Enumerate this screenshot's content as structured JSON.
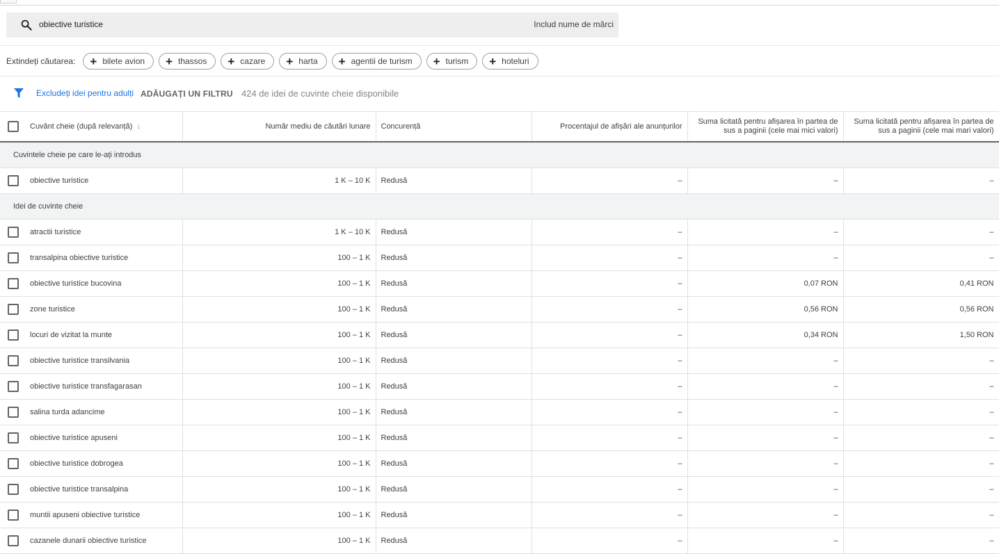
{
  "search": {
    "query": "obiective turistice",
    "brand_toggle": "Includ nume de mărci"
  },
  "expand": {
    "label": "Extindeți căutarea:",
    "chips": [
      "bilete avion",
      "thassos",
      "cazare",
      "harta",
      "agentii de turism",
      "turism",
      "hoteluri"
    ]
  },
  "filters": {
    "exclude_adult": "Excludeți idei pentru adulți",
    "add_filter": "ADĂUGAȚI UN FILTRU",
    "available_count": "424 de idei de cuvinte cheie disponibile"
  },
  "table": {
    "headers": {
      "keyword": "Cuvânt cheie (după relevanță)",
      "avg_searches": "Număr mediu de căutări lunare",
      "competition": "Concurență",
      "impr_share": "Procentajul de afișări ale anunțurilor",
      "bid_low_1": "Suma licitată pentru afișarea în partea de",
      "bid_low_2": "sus a paginii (cele mai mici valori)",
      "bid_high_1": "Suma licitată pentru afișarea în partea de",
      "bid_high_2": "sus a paginii (cele mai mari valori)"
    },
    "section_entered": "Cuvintele cheie pe care le-ați introdus",
    "entered_row": {
      "keyword": "obiective turistice",
      "searches": "1 K – 10 K",
      "competition": "Redusă",
      "share": "–",
      "low": "–",
      "high": "–"
    },
    "section_ideas": "Idei de cuvinte cheie",
    "rows": [
      {
        "keyword": "atractii turistice",
        "searches": "1 K – 10 K",
        "competition": "Redusă",
        "share": "–",
        "low": "–",
        "high": "–"
      },
      {
        "keyword": "transalpina obiective turistice",
        "searches": "100 – 1 K",
        "competition": "Redusă",
        "share": "–",
        "low": "–",
        "high": "–"
      },
      {
        "keyword": "obiective turistice bucovina",
        "searches": "100 – 1 K",
        "competition": "Redusă",
        "share": "–",
        "low": "0,07 RON",
        "high": "0,41 RON"
      },
      {
        "keyword": "zone turistice",
        "searches": "100 – 1 K",
        "competition": "Redusă",
        "share": "–",
        "low": "0,56 RON",
        "high": "0,56 RON"
      },
      {
        "keyword": "locuri de vizitat la munte",
        "searches": "100 – 1 K",
        "competition": "Redusă",
        "share": "–",
        "low": "0,34 RON",
        "high": "1,50 RON"
      },
      {
        "keyword": "obiective turistice transilvania",
        "searches": "100 – 1 K",
        "competition": "Redusă",
        "share": "–",
        "low": "–",
        "high": "–"
      },
      {
        "keyword": "obiective turistice transfagarasan",
        "searches": "100 – 1 K",
        "competition": "Redusă",
        "share": "–",
        "low": "–",
        "high": "–"
      },
      {
        "keyword": "salina turda adancime",
        "searches": "100 – 1 K",
        "competition": "Redusă",
        "share": "–",
        "low": "–",
        "high": "–"
      },
      {
        "keyword": "obiective turistice apuseni",
        "searches": "100 – 1 K",
        "competition": "Redusă",
        "share": "–",
        "low": "–",
        "high": "–"
      },
      {
        "keyword": "obiective turistice dobrogea",
        "searches": "100 – 1 K",
        "competition": "Redusă",
        "share": "–",
        "low": "–",
        "high": "–"
      },
      {
        "keyword": "obiective turistice transalpina",
        "searches": "100 – 1 K",
        "competition": "Redusă",
        "share": "–",
        "low": "–",
        "high": "–"
      },
      {
        "keyword": "muntii apuseni obiective turistice",
        "searches": "100 – 1 K",
        "competition": "Redusă",
        "share": "–",
        "low": "–",
        "high": "–"
      },
      {
        "keyword": "cazanele dunarii obiective turistice",
        "searches": "100 – 1 K",
        "competition": "Redusă",
        "share": "–",
        "low": "–",
        "high": "–"
      }
    ]
  },
  "colors": {
    "accent": "#1a73e8",
    "section_bg": "#f1f3f4",
    "search_bg": "#eeeeee"
  }
}
